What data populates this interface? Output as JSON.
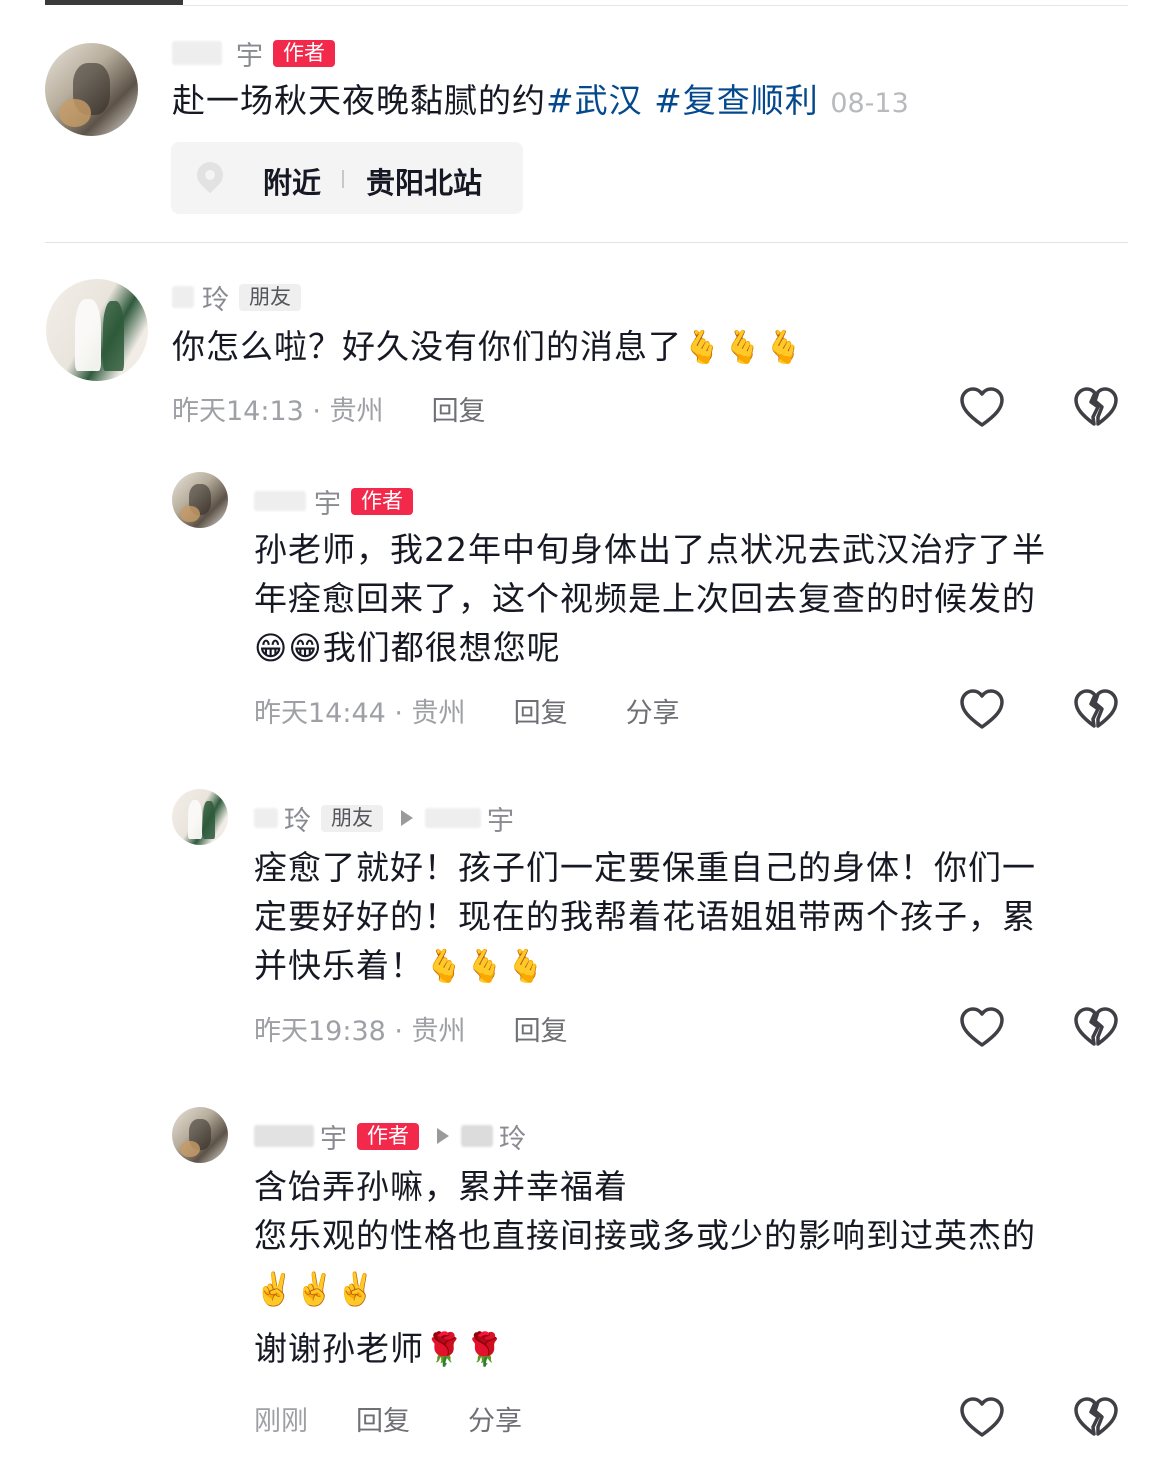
{
  "post": {
    "author_name": "宇",
    "author_badge": "作者",
    "text": "赴一场秋天夜晚黏腻的约",
    "hashtags": [
      "#武汉",
      "#复查顺利"
    ],
    "date": "08-13",
    "location": {
      "label": "附近",
      "place": "贵阳北站"
    }
  },
  "comments": [
    {
      "name": "玲",
      "badge": "朋友",
      "text": "你怎么啦？好久没有你们的消息了",
      "emoji": "🫰🫰🫰",
      "time": "昨天14:13 · 贵州",
      "reply": "回复"
    }
  ],
  "replies": [
    {
      "name": "宇",
      "badge": "作者",
      "lines": [
        "孙老师，我22年中旬身体出了点状况去武汉治疗了半",
        "年痊愈回来了，这个视频是上次回去复查的时候发的"
      ],
      "line3_emoji": "😁😁",
      "line3_text": "我们都很想您呢",
      "time": "昨天14:44 · 贵州",
      "reply": "回复",
      "share": "分享"
    },
    {
      "name": "玲",
      "badge": "朋友",
      "to": "宇",
      "lines": [
        "痊愈了就好！孩子们一定要保重自己的身体！你们一",
        "定要好好的！现在的我帮着花语姐姐带两个孩子，累"
      ],
      "line3_text": "并快乐着！",
      "line3_emoji": "🫰🫰🫰",
      "time": "昨天19:38 · 贵州",
      "reply": "回复"
    },
    {
      "name": "宇",
      "badge": "作者",
      "to": "玲",
      "lines": [
        "含饴弄孙嘛，累并幸福着",
        "您乐观的性格也直接间接或多或少的影响到过英杰的"
      ],
      "emoji_line": "✌️✌️✌️",
      "last_text": "谢谢孙老师",
      "last_emoji": "🌹🌹",
      "time": "刚刚",
      "reply": "回复",
      "share": "分享"
    }
  ],
  "icons": {
    "like": "heart-outline-icon",
    "dislike": "broken-heart-icon"
  }
}
